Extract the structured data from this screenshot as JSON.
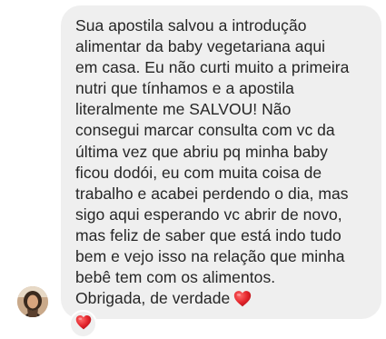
{
  "message": {
    "text": "Sua apostila salvou a introdução\nalimentar da baby vegetariana aqui\nem casa. Eu não curti muito a primeira\nnutri que tínhamos e a apostila\nliteralmente me SALVOU! Não\nconsegui marcar consulta com vc da\núltima vez que abriu pq minha baby\nficou dodói, eu com muita coisa de\ntrabalho e acabei perdendo o dia, mas\nsigo aqui esperando vc abrir de novo,\nmas feliz de saber que está indo tudo\nbem e vejo isso na relação que minha\nbebê tem com os alimentos.\nObrigada, de verdade",
    "inline_icon": "red-heart-emoji"
  },
  "reaction": {
    "icon": "red-heart-emoji"
  },
  "sender": {
    "avatar_icon": "profile-photo"
  },
  "colors": {
    "bubble": "#efefef",
    "text": "#262626",
    "heart": "#e3242b"
  }
}
